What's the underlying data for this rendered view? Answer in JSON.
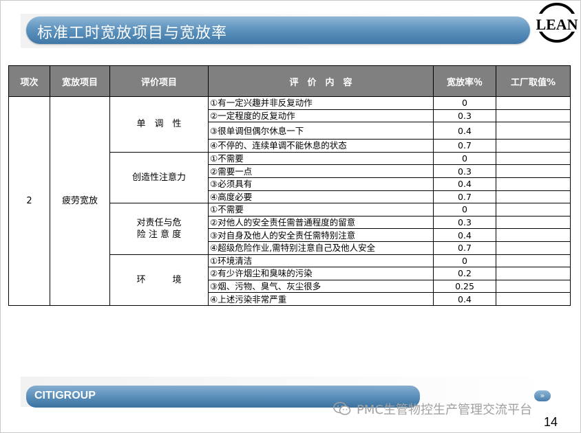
{
  "slide": {
    "title": "标准工时宽放项目与宽放率",
    "logo_text": "LEAN",
    "footer_label": "CITIGROUP",
    "nav_button": "»",
    "watermark": "PMC生管物控生产管理交流平台",
    "page_number": "14",
    "colors": {
      "banner": "#5f94bf",
      "header": "#808080"
    }
  },
  "table": {
    "headers": [
      "项次",
      "宽放项目",
      "评价项目",
      "评　价　内　容",
      "宽放率％",
      "工厂取值%"
    ],
    "item_no": "2",
    "item_name": "疲劳宽放",
    "groups": [
      {
        "name": "单　调　性",
        "rows": [
          {
            "desc": "①有一定兴趣并非反复动作",
            "rate": "0",
            "factory": ""
          },
          {
            "desc": "②一定程度的反复动作",
            "rate": "0.3",
            "factory": ""
          },
          {
            "desc": "③很单调但偶尔休息一下",
            "rate": "0.4",
            "factory": ""
          },
          {
            "desc": "④不停的、连续单调不能休息的状态",
            "rate": "0.7",
            "factory": ""
          }
        ]
      },
      {
        "name": "创造性注意力",
        "rows": [
          {
            "desc": "①不需要",
            "rate": "0",
            "factory": ""
          },
          {
            "desc": "②需要一点",
            "rate": "0.3",
            "factory": ""
          },
          {
            "desc": "③必须具有",
            "rate": "0.4",
            "factory": ""
          },
          {
            "desc": "④高度必要",
            "rate": "0.7",
            "factory": ""
          }
        ]
      },
      {
        "name_line1": "对责任与危",
        "name_line2": "险 注 意 度",
        "rows": [
          {
            "desc": "①不需要",
            "rate": "0",
            "factory": ""
          },
          {
            "desc": "②对他人的安全责任需普通程度的留意",
            "rate": "0.3",
            "factory": ""
          },
          {
            "desc": "③对自身及他人的安全责任需特别注意",
            "rate": "0.4",
            "factory": ""
          },
          {
            "desc": "④超级危险作业,需特别注意自己及他人安全",
            "rate": "0.7",
            "factory": ""
          }
        ]
      },
      {
        "name": "环　　　境",
        "rows": [
          {
            "desc": "①环境清洁",
            "rate": "0",
            "factory": ""
          },
          {
            "desc": "②有少许烟尘和臭味的污染",
            "rate": "0.2",
            "factory": ""
          },
          {
            "desc": "③烟、污物、臭气、灰尘很多",
            "rate": "0.25",
            "factory": ""
          },
          {
            "desc": "④上述污染非常严重",
            "rate": "0.4",
            "factory": ""
          }
        ]
      }
    ]
  }
}
